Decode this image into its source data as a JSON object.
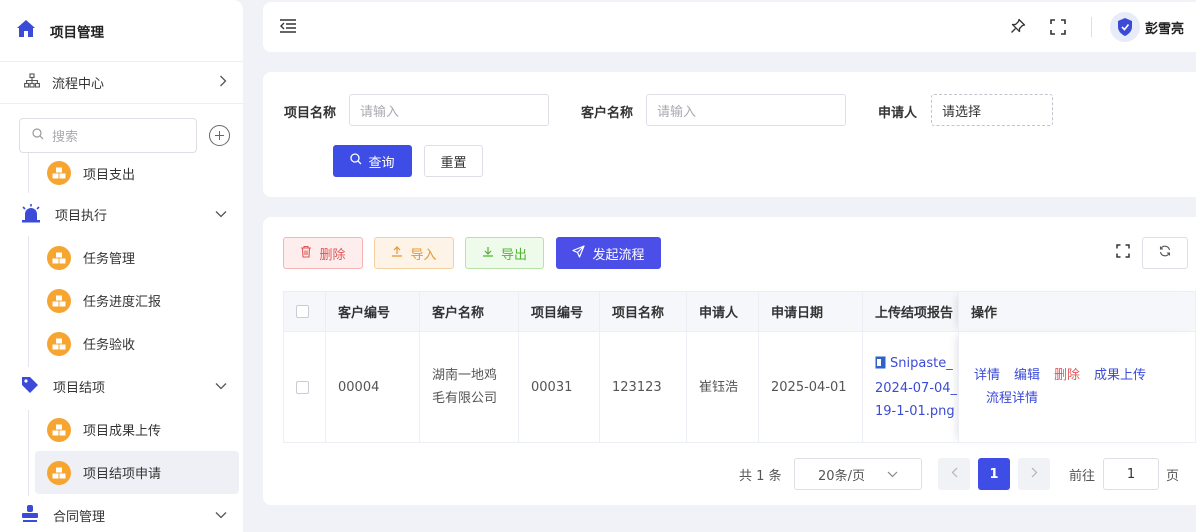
{
  "sidebar": {
    "app_title": "项目管理",
    "flow_center": "流程中心",
    "search_placeholder": "搜索",
    "items": [
      {
        "label": "项目支出"
      },
      {
        "label": "项目执行"
      },
      {
        "label": "任务管理"
      },
      {
        "label": "任务进度汇报"
      },
      {
        "label": "任务验收"
      },
      {
        "label": "项目结项"
      },
      {
        "label": "项目成果上传"
      },
      {
        "label": "项目结项申请"
      },
      {
        "label": "合同管理"
      }
    ]
  },
  "header": {
    "user_name": "彭雪亮"
  },
  "query": {
    "project_name_label": "项目名称",
    "project_name_placeholder": "请输入",
    "customer_name_label": "客户名称",
    "customer_name_placeholder": "请输入",
    "applicant_label": "申请人",
    "applicant_placeholder": "请选择",
    "search_button": "查询",
    "reset_button": "重置"
  },
  "toolbar": {
    "delete": "删除",
    "import": "导入",
    "export": "导出",
    "start_flow": "发起流程"
  },
  "table": {
    "columns": [
      "客户编号",
      "客户名称",
      "项目编号",
      "项目名称",
      "申请人",
      "申请日期",
      "上传结项报告",
      "操作"
    ],
    "rows": [
      {
        "customer_no": "00004",
        "customer_name": "湖南一地鸡毛有限公司",
        "project_no": "00031",
        "project_name": "123123",
        "applicant": "崔钰浩",
        "apply_date": "2025-04-01",
        "report_file": "Snipaste_2024-07-04_19-1-01.png",
        "ops": [
          "详情",
          "编辑",
          "删除",
          "成果上传",
          "流程详情"
        ]
      }
    ]
  },
  "pagination": {
    "total": "共 1 条",
    "page_size": "20条/页",
    "current_page": "1",
    "goto_label": "前往",
    "goto_value": "1",
    "page_suffix": "页"
  },
  "colors": {
    "primary": "#3d4de6",
    "danger": "#e25555",
    "warning": "#e8962e",
    "success": "#52b434",
    "menu_icon": "#f6a531"
  }
}
